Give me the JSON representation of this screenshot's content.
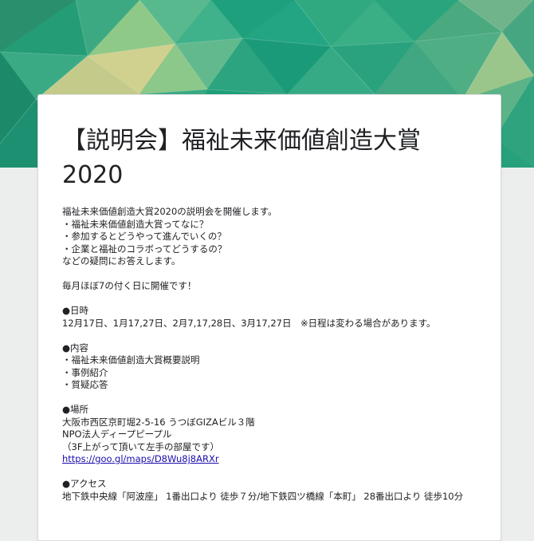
{
  "form": {
    "title": "【説明会】福祉未来価値創造大賞2020",
    "description": {
      "intro": "福祉未来価値創造大賞2020の説明会を開催します。",
      "question_1": "・福祉未来価値創造大賞ってなに？",
      "question_2": "・参加するとどうやって進んでいくの？",
      "question_3": "・企業と福祉のコラボってどうするの？",
      "outro": "などの疑問にお答えします。",
      "schedule_note": "毎月ほぼ7の付く日に開催です！",
      "date_heading": "●日時",
      "dates": "12月17日、1月17,27日、2月7,17,28日、3月17,27日　※日程は変わる場合があります。",
      "content_heading": "●内容",
      "content_1": "・福祉未来価値創造大賞概要説明",
      "content_2": "・事例紹介",
      "content_3": "・質疑応答",
      "place_heading": "●場所",
      "address": "大阪市西区京町堀2-5-16 うつぼGIZAビル３階",
      "organization": "NPO法人ディープピープル",
      "direction": "（3F上がって頂いて左手の部屋です）",
      "map_link": "https://goo.gl/maps/D8Wu8j8ARXr",
      "access_heading": "●アクセス",
      "access": "地下鉄中央線「阿波座」 1番出口より 徒歩７分/地下鉄四ツ橋線「本町」 28番出口より 徒歩10分"
    }
  },
  "theme": {
    "banner_base": "#1f9f78",
    "card_background": "#ffffff",
    "page_background": "#eceeed",
    "link_color": "#1a0dab"
  }
}
